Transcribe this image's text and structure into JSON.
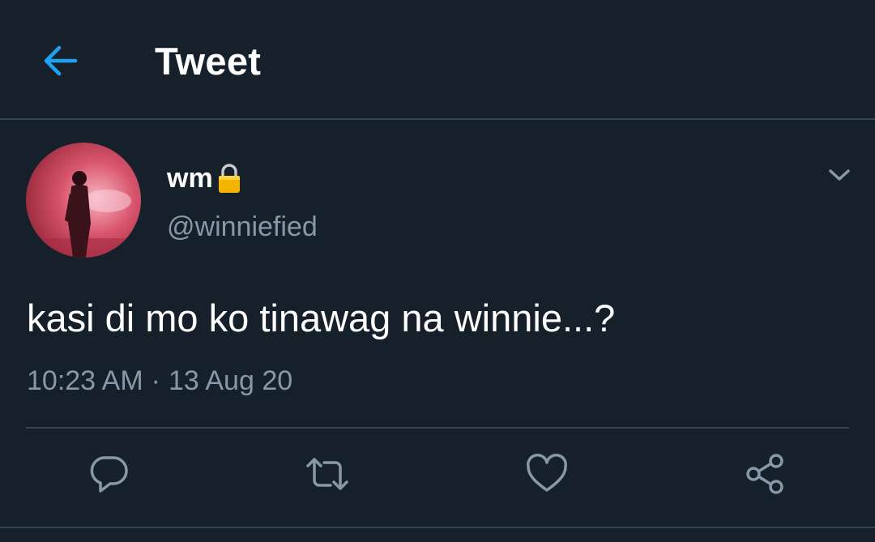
{
  "header": {
    "title": "Tweet",
    "back_icon": "arrow-left-icon"
  },
  "tweet": {
    "display_name": "wm",
    "protected_icon": "lock-icon",
    "handle": "@winniefied",
    "text": "kasi di mo ko tinawag na winnie...?",
    "time": "10:23 AM",
    "separator": "·",
    "date": "13 Aug 20"
  },
  "actions": {
    "reply_icon": "reply-icon",
    "retweet_icon": "retweet-icon",
    "like_icon": "heart-icon",
    "share_icon": "share-icon"
  },
  "colors": {
    "background": "#15202b",
    "accent": "#1da1f2",
    "secondary_text": "#8899a6",
    "divider": "#38444d"
  }
}
